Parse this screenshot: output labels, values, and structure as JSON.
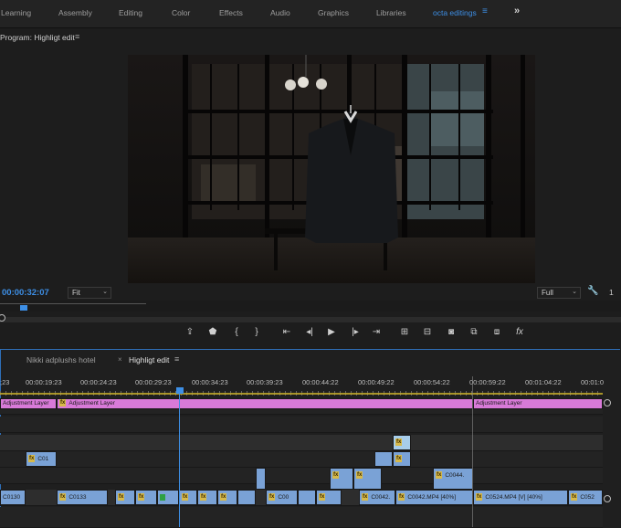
{
  "workspace_tabs": [
    "Learning",
    "Assembly",
    "Editing",
    "Color",
    "Effects",
    "Audio",
    "Graphics",
    "Libraries",
    "octa editings"
  ],
  "workspace_more": "»",
  "program": {
    "title": "Program: Highligt edit",
    "timecode": "00:00:32:07",
    "fit": "Fit",
    "quality": "Full",
    "fraction": "1"
  },
  "sequence_tabs": [
    "Nikki adplushs hotel",
    "Highligt edit"
  ],
  "ruler": [
    ";23",
    "00:00:19:23",
    "00:00:24:23",
    "00:00:29:23",
    "00:00:34:23",
    "00:00:39:23",
    "00:00:44:22",
    "00:00:49:22",
    "00:00:54:22",
    "00:00:59:22",
    "00:01:04:22",
    "00:01:0"
  ],
  "clips": {
    "adj1": "Adjustment Layer",
    "adj2": "Adjustment Layer",
    "adj3": "Adjustment Layer",
    "c01": "C01",
    "c0044": "C0044.",
    "c0130": "C0130",
    "c0133": "C0133",
    "c00": "C00",
    "c0042a": "C0042.",
    "c0042b": "C0042.MP4 [40%]",
    "c0524": "C0524.MP4 [V] [40%]",
    "c052": "C052",
    "fx": "fx"
  },
  "icons": [
    "export-frame-icon",
    "marker-icon",
    "in-point-icon",
    "out-point-icon",
    "go-to-in-icon",
    "step-back-icon",
    "play-icon",
    "step-forward-icon",
    "go-to-out-icon",
    "lift-icon",
    "extract-icon",
    "camera-icon",
    "compare-icon",
    "multi-icon",
    "fx-icon"
  ]
}
